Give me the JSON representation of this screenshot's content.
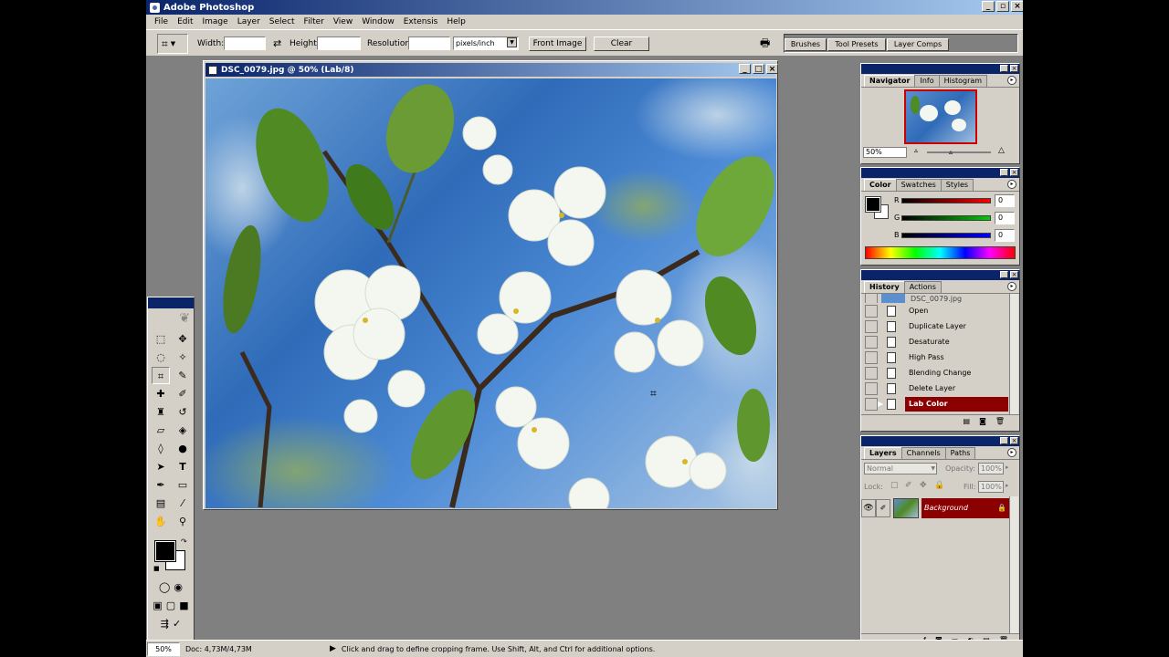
{
  "app": {
    "title": "Adobe Photoshop"
  },
  "menu": [
    "File",
    "Edit",
    "Image",
    "Layer",
    "Select",
    "Filter",
    "View",
    "Window",
    "Extensis",
    "Help"
  ],
  "options": {
    "width_label": "Width:",
    "height_label": "Height:",
    "resolution_label": "Resolution:",
    "units": "pixels/inch",
    "front_image": "Front Image",
    "clear": "Clear"
  },
  "palette_well": [
    "Brushes",
    "Tool Presets",
    "Layer Comps"
  ],
  "document": {
    "title": "DSC_0079.jpg @ 50% (Lab/8)"
  },
  "navigator": {
    "tabs": [
      "Navigator",
      "Info",
      "Histogram"
    ],
    "zoom": "50%"
  },
  "color": {
    "tabs": [
      "Color",
      "Swatches",
      "Styles"
    ],
    "channels": [
      {
        "letter": "R",
        "value": "0"
      },
      {
        "letter": "G",
        "value": "0"
      },
      {
        "letter": "B",
        "value": "0"
      }
    ]
  },
  "history": {
    "tabs": [
      "History",
      "Actions"
    ],
    "snapshot": "DSC_0079.jpg",
    "items": [
      "Open",
      "Duplicate Layer",
      "Desaturate",
      "High Pass",
      "Blending Change",
      "Delete Layer",
      "Lab Color"
    ]
  },
  "layers": {
    "tabs": [
      "Layers",
      "Channels",
      "Paths"
    ],
    "blend_mode": "Normal",
    "opacity_label": "Opacity:",
    "opacity": "100%",
    "lock_label": "Lock:",
    "fill_label": "Fill:",
    "fill": "100%",
    "layer_name": "Background"
  },
  "status": {
    "zoom": "50%",
    "doc": "Doc: 4,73M/4,73M",
    "hint": "Click and drag to define cropping frame. Use Shift, Alt, and Ctrl for additional options."
  },
  "colors": {
    "titlebar": "#0a246a",
    "selection": "#8b0000",
    "chrome": "#d4d0c8",
    "workspace": "#808080"
  }
}
